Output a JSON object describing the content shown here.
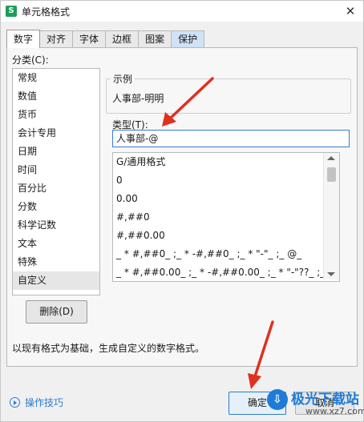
{
  "window": {
    "title": "单元格格式",
    "app_icon": "S",
    "close_glyph": "✕"
  },
  "tabs": [
    {
      "label": "数字",
      "active": true
    },
    {
      "label": "对齐"
    },
    {
      "label": "字体"
    },
    {
      "label": "边框"
    },
    {
      "label": "图案"
    },
    {
      "label": "保护"
    }
  ],
  "category": {
    "label": "分类(C):",
    "items": [
      "常规",
      "数值",
      "货币",
      "会计专用",
      "日期",
      "时间",
      "百分比",
      "分数",
      "科学记数",
      "文本",
      "特殊",
      "自定义"
    ],
    "selected_index": 11
  },
  "sample": {
    "legend": "示例",
    "value": "人事部-明明"
  },
  "type": {
    "label": "类型(T):",
    "value": "人事部-@"
  },
  "formats": [
    "G/通用格式",
    "0",
    "0.00",
    "#,##0",
    "#,##0.00",
    "_ * #,##0_ ;_ * -#,##0_ ;_ * \"-\"_ ;_ @_",
    "_ * #,##0.00_ ;_ * -#,##0.00_ ;_ * \"-\"??_ ;_ @_"
  ],
  "delete_button": "删除(D)",
  "description": "以现有格式为基础，生成自定义的数字格式。",
  "footer": {
    "tips": "操作技巧",
    "ok": "确定",
    "cancel": "取消"
  },
  "watermark": {
    "brand": "极光下载站",
    "url": "www.xz7.com"
  },
  "colors": {
    "accent": "#2d7cc9",
    "annotation_arrow": "#e0301e",
    "app_icon": "#1a9e5a"
  }
}
